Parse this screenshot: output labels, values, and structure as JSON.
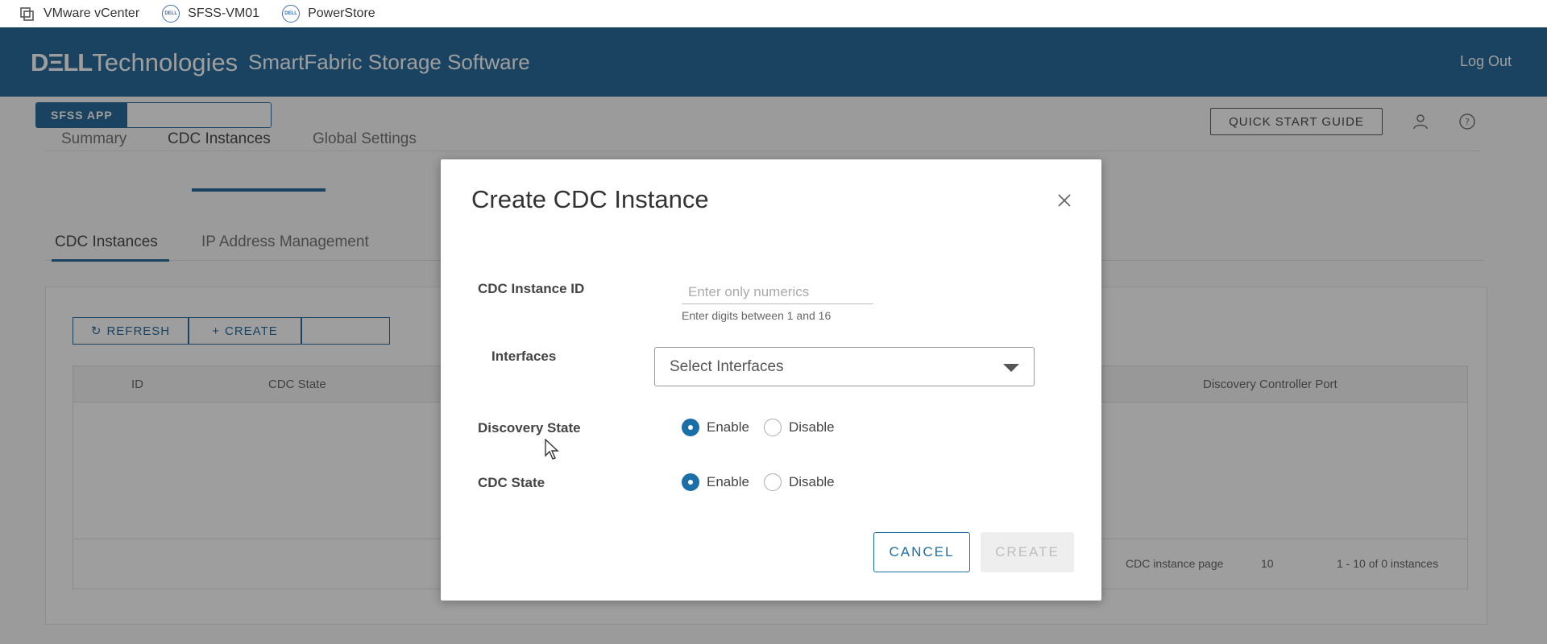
{
  "bookmarks": [
    {
      "label": "VMware vCenter",
      "icon": "vmware-icon"
    },
    {
      "label": "SFSS-VM01",
      "icon": "dell-icon"
    },
    {
      "label": "PowerStore",
      "icon": "dell-icon"
    }
  ],
  "header": {
    "brand_dell": "DΞLL",
    "brand_tech": "Technologies",
    "product": "SmartFabric Storage Software",
    "logout": "Log Out",
    "color": "#0e5a8e"
  },
  "app_tabs": [
    "SFSS APP",
    ""
  ],
  "quick_start": "QUICK START GUIDE",
  "main_tabs": [
    "Summary",
    "CDC Instances",
    "Global Settings"
  ],
  "sub_tabs": [
    "CDC Instances",
    "IP Address Management"
  ],
  "toolbar": {
    "refresh": "REFRESH",
    "create": "CREATE"
  },
  "grid": {
    "columns": [
      "ID",
      "CDC State",
      "Discovery Controller Port"
    ],
    "footer_page_label": "CDC instance page",
    "footer_page_size": "10",
    "footer_count": "1 - 10 of 0 instances"
  },
  "modal": {
    "title": "Create CDC Instance",
    "fields": {
      "instance_id": {
        "label": "CDC Instance ID",
        "placeholder": "Enter only numerics",
        "helper": "Enter digits between 1 and 16"
      },
      "interfaces": {
        "label": "Interfaces",
        "placeholder": "Select Interfaces"
      },
      "discovery_state": {
        "label": "Discovery State",
        "options": [
          "Enable",
          "Disable"
        ],
        "selected": "Enable"
      },
      "cdc_state": {
        "label": "CDC State",
        "options": [
          "Enable",
          "Disable"
        ],
        "selected": "Enable"
      }
    },
    "cancel": "CANCEL",
    "create": "CREATE",
    "accent": "#1b6fa8"
  }
}
